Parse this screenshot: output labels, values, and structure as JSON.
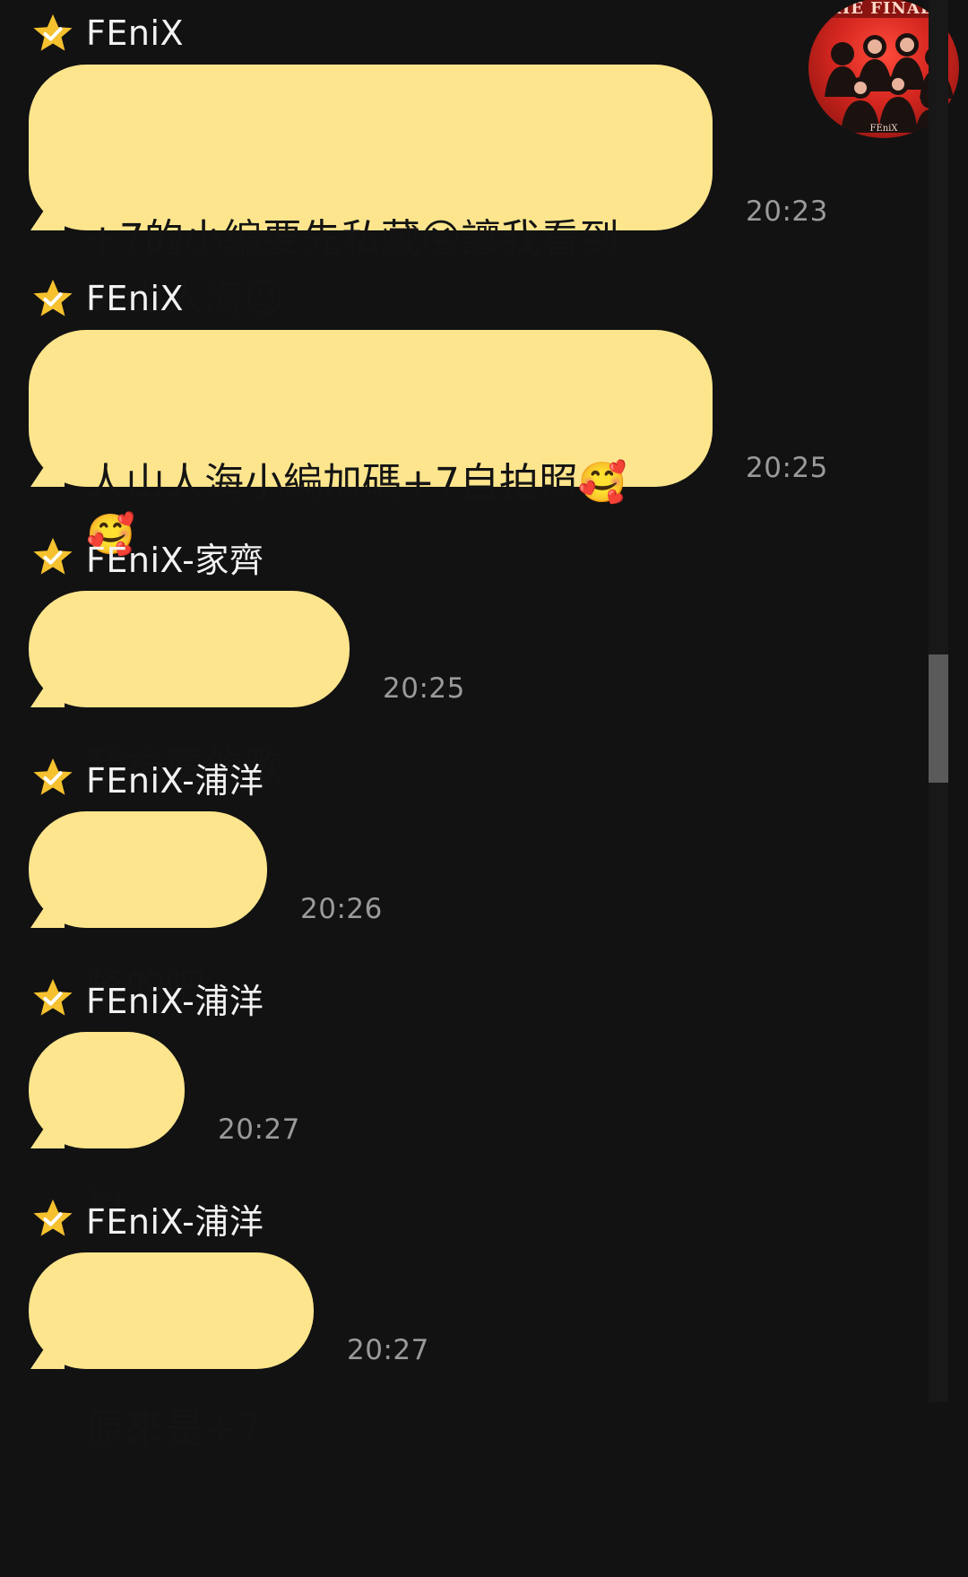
{
  "chat": {
    "messages": [
      {
        "sender": "FEniX",
        "text": "+7的小編要先私藏😝讓我看到\n人山人海😍",
        "time": "20:23"
      },
      {
        "sender": "FEniX",
        "text": "人山人海小編加碼+7自拍照🥰\n🥰",
        "time": "20:25"
      },
      {
        "sender": "FEniX-家齊",
        "text": "我推薦的歌",
        "time": "20:25"
      },
      {
        "sender": "FEniX-浦洋",
        "text": "隆的吧",
        "time": "20:26"
      },
      {
        "sender": "FEniX-浦洋",
        "text": "對",
        "time": "20:27"
      },
      {
        "sender": "FEniX-浦洋",
        "text": "原來是+7",
        "time": "20:27"
      }
    ]
  },
  "avatar": {
    "icon": "group-avatar",
    "brand_text": "FEniX"
  },
  "colors": {
    "background": "#121212",
    "bubble": "#fde58d",
    "star": "#f5c12e",
    "time": "#9a9a9a"
  }
}
